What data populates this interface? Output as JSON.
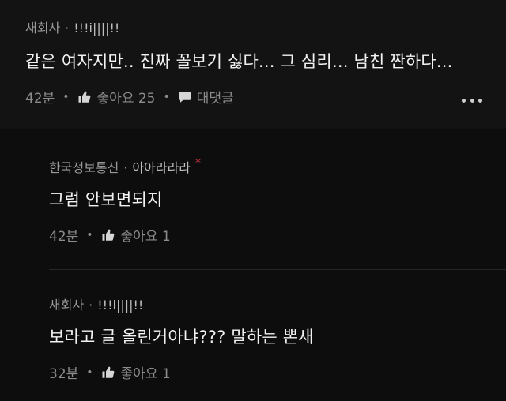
{
  "post": {
    "company": "새회사",
    "nickname": "!!!i||||!!",
    "text": "같은 여자지만.. 진짜 꼴보기 싫다... 그 심리... 남친 짠하다...",
    "time": "42분",
    "like_label": "좋아요 25",
    "reply_label": "대댓글",
    "icons": {
      "like": "thumbs-up-icon",
      "reply": "comment-bubble-icon",
      "more": "more-options-icon"
    }
  },
  "replies": [
    {
      "company": "한국정보통신",
      "nickname": "아아라라라",
      "badge": "*",
      "text": "그럼 안보면되지",
      "time": "42분",
      "like_label": "좋아요 1"
    },
    {
      "company": "새회사",
      "nickname": "!!!i||||!!",
      "text": "보라고 글 올린거아냐??? 말하는 뽄새",
      "time": "32분",
      "like_label": "좋아요 1"
    }
  ],
  "colors": {
    "background": "#0d0d0d",
    "post_background": "#131313",
    "author_badge": "#e0344a"
  }
}
